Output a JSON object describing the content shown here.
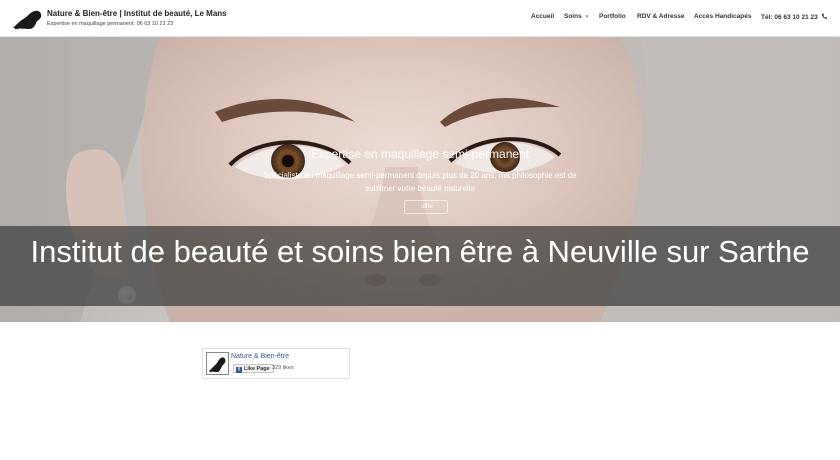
{
  "header": {
    "brand_title": "Nature & Bien-être | Institut de beauté, Le Mans",
    "brand_subtitle": "Expertise en maquillage permanent: 06 63 10 21 23",
    "logo_icon": "woman-silhouette-icon",
    "nav": {
      "accueil": "Accueil",
      "soins": "Soins",
      "portfolio": "Portfolio",
      "rdv": "RDV & Adresse",
      "acces": "Accès Handicapés",
      "tel": "Tél: 06 63 10 21 23"
    }
  },
  "hero": {
    "slide_title": "Expertise en maquillage semi-permanent",
    "slide_text": "Spécialiste du maquillage semi-permanent depuis plus de 20 ans, ma philosophie est de sublimer votre beauté naturelle",
    "slide_button": "offre",
    "banner_title": "Institut de beauté et soins bien être à Neuville sur Sarthe"
  },
  "facebook": {
    "page_name": "Nature & Bien-être",
    "like_label": "Like Page",
    "likes": "329 likes",
    "brand_color": "#3b5998"
  }
}
